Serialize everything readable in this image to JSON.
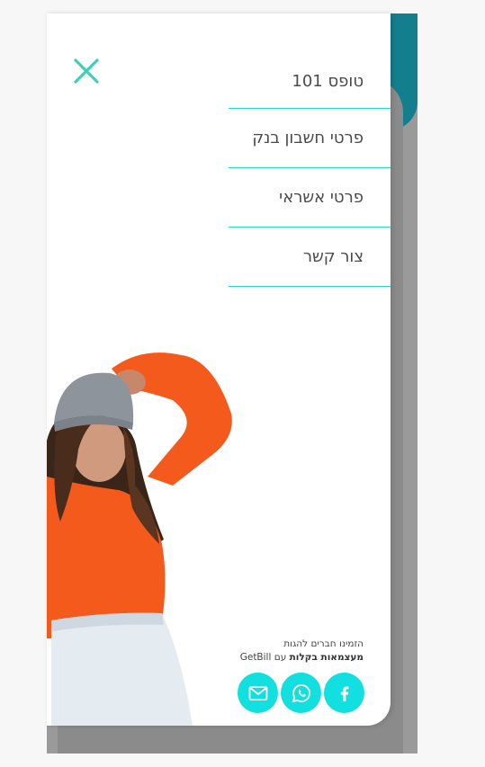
{
  "menu": {
    "close_icon": "close-x-icon",
    "items": [
      {
        "label": "טופס 101"
      },
      {
        "label": "פרטי חשבון בנק"
      },
      {
        "label": "פרטי אשראי"
      },
      {
        "label": "צור קשר"
      }
    ]
  },
  "footer": {
    "line1": "הזמינו חברים להגות",
    "line2_bold": "מעצמאות בקלות",
    "line2_rest": " עם GetBill"
  },
  "social": [
    {
      "icon": "facebook-icon"
    },
    {
      "icon": "whatsapp-icon"
    },
    {
      "icon": "email-icon"
    }
  ],
  "colors": {
    "accent": "#2dd4c8",
    "social_bg": "#12dfe0",
    "close_icon": "#3fd0b4",
    "sweater": "#f45a1c",
    "beanie": "#8d949b"
  }
}
